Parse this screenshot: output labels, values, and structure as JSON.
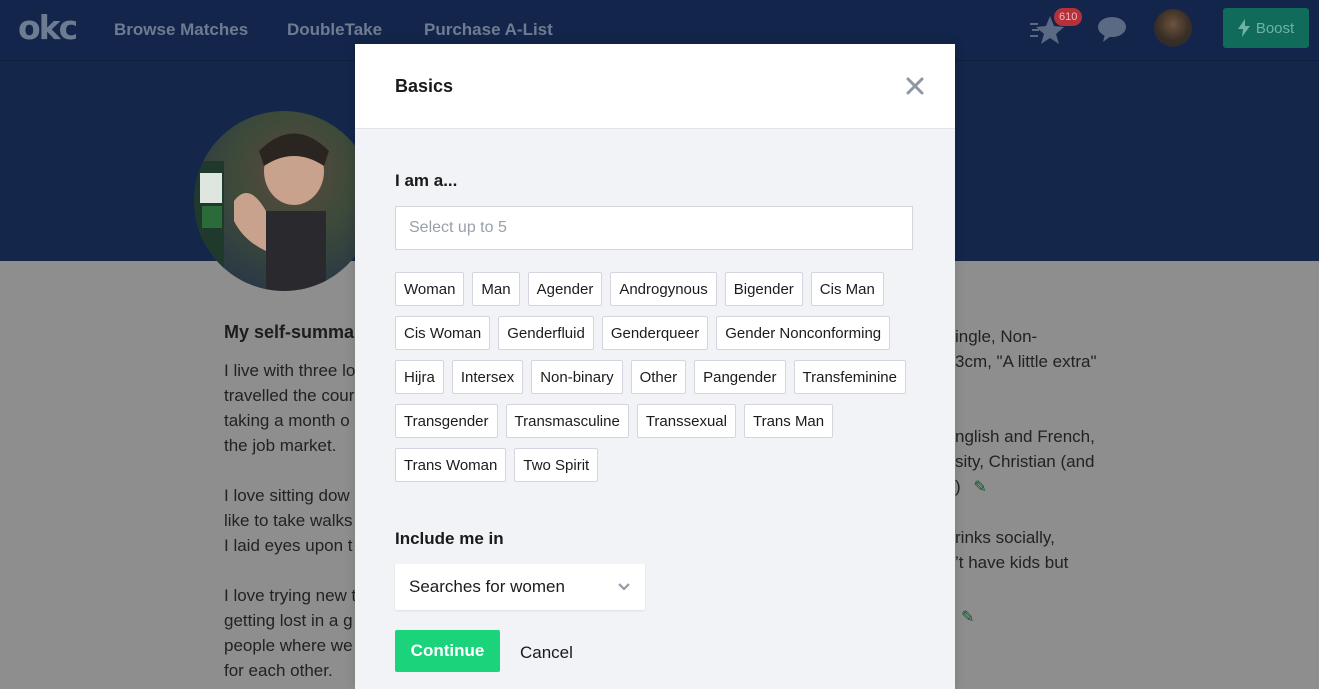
{
  "nav": {
    "logo": "okc",
    "links": [
      "Browse Matches",
      "DoubleTake",
      "Purchase A-List"
    ],
    "badge_count": "610",
    "boost_label": "Boost"
  },
  "background": {
    "section_heading": "My self-summa",
    "left_lines": [
      "I live with three lo",
      "travelled the cour",
      "taking a month o",
      "the job market.",
      "",
      "I love sitting dow",
      "like to take walks",
      "I laid eyes upon t",
      "",
      "I love trying new t",
      "getting lost in a g",
      "people where we",
      "for each other."
    ],
    "right_lines": [
      "ingle, Non-",
      "3cm, \"A little extra\"",
      "",
      "",
      "nglish and French,",
      "sity, Christian (and",
      ")",
      "",
      "rinks socially,",
      "’t have kids but"
    ]
  },
  "modal": {
    "title": "Basics",
    "gender_section": {
      "label": "I am a...",
      "placeholder": "Select up to 5",
      "options": [
        "Woman",
        "Man",
        "Agender",
        "Androgynous",
        "Bigender",
        "Cis Man",
        "Cis Woman",
        "Genderfluid",
        "Genderqueer",
        "Gender Nonconforming",
        "Hijra",
        "Intersex",
        "Non-binary",
        "Other",
        "Pangender",
        "Transfeminine",
        "Transgender",
        "Transmasculine",
        "Transsexual",
        "Trans Man",
        "Trans Woman",
        "Two Spirit"
      ]
    },
    "include_section": {
      "label": "Include me in",
      "selected": "Searches for women"
    },
    "continue_label": "Continue",
    "cancel_label": "Cancel"
  },
  "colors": {
    "accent_green": "#1ad37b",
    "nav_bg": "#13254a",
    "modal_bg": "#f2f3f7"
  },
  "icons": [
    "star-icon",
    "chat-icon",
    "lightning-icon",
    "close-icon",
    "chevron-down-icon",
    "pencil-icon"
  ]
}
